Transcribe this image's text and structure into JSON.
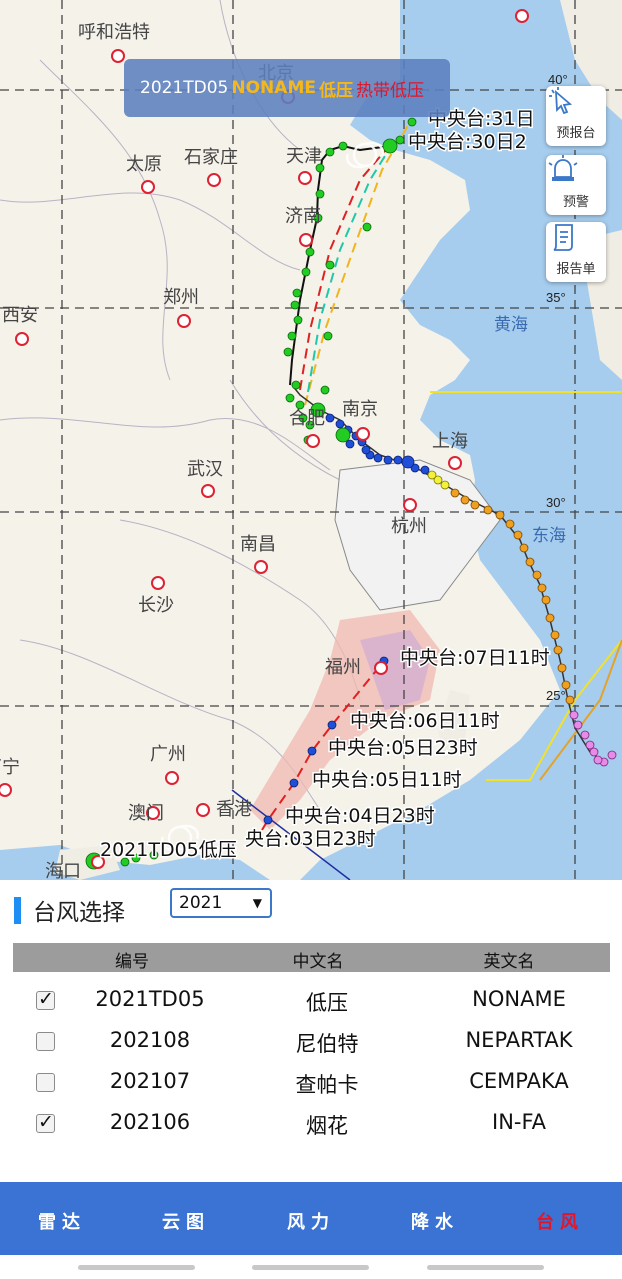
{
  "map": {
    "banner": {
      "code": "2021TD05",
      "name_en": "NONAME",
      "name_cn": "低压",
      "level": "热带低压"
    },
    "cities": [
      "呼和浩特",
      "北京",
      "太原",
      "石家庄",
      "天津",
      "济南",
      "西安",
      "郑州",
      "南京",
      "合肥",
      "上海",
      "武汉",
      "杭州",
      "南昌",
      "长沙",
      "福州",
      "广州",
      "澳门",
      "香港",
      "海口",
      "南宁"
    ],
    "seas": [
      "黄海",
      "东海"
    ],
    "lat_labels": [
      "40°",
      "35°",
      "30°",
      "25°"
    ],
    "forecasts": {
      "f1": "中央台:31日",
      "f2": "中央台:30日2",
      "f3": "中央台:07日11时",
      "f4": "中央台:06日11时",
      "f5": "中央台:05日23时",
      "f6": "中央台:05日11时",
      "f7": "中央台:04日23时",
      "f8": "央台:03日23时"
    },
    "storm_label": "2021TD05低压"
  },
  "side_buttons": [
    {
      "label": "预报台",
      "icon": "cursor-click-icon"
    },
    {
      "label": "预警",
      "icon": "alarm-bell-icon"
    },
    {
      "label": "报告单",
      "icon": "scroll-report-icon"
    }
  ],
  "panel": {
    "title": "台风选择",
    "year": "2021",
    "columns": [
      "编号",
      "中文名",
      "英文名"
    ],
    "rows": [
      {
        "id": "2021TD05",
        "cn": "低压",
        "en": "NONAME",
        "checked": true
      },
      {
        "id": "202108",
        "cn": "尼伯特",
        "en": "NEPARTAK",
        "checked": false
      },
      {
        "id": "202107",
        "cn": "查帕卡",
        "en": "CEMPAKA",
        "checked": false
      },
      {
        "id": "202106",
        "cn": "烟花",
        "en": "IN-FA",
        "checked": true
      }
    ]
  },
  "nav": [
    {
      "label": "雷达",
      "active": false
    },
    {
      "label": "云图",
      "active": false
    },
    {
      "label": "风力",
      "active": false
    },
    {
      "label": "降水",
      "active": false
    },
    {
      "label": "台风",
      "active": true
    }
  ],
  "colors": {
    "accent": "#1e8ff2",
    "navbar": "#3a73d3",
    "active": "#e0162b",
    "track_green": "#22cc22",
    "track_orange": "#f0a020",
    "track_blue": "#1f4fd8"
  }
}
